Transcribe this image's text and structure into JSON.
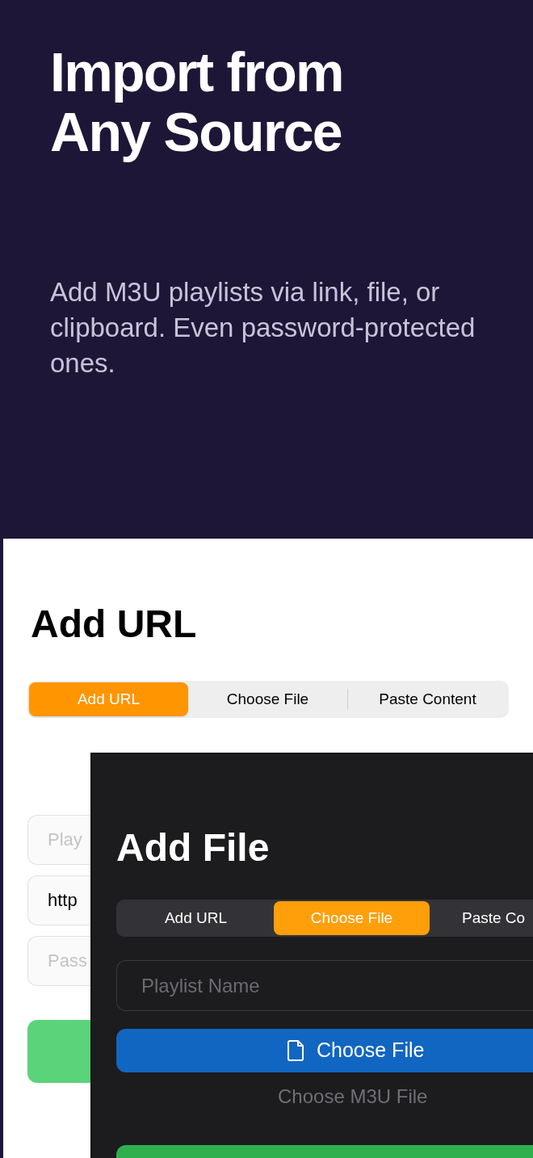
{
  "hero": {
    "title": "Import from Any Source",
    "subtitle": "Add M3U playlists via link, file, or clipboard. Even password-protected ones."
  },
  "url_screen": {
    "title": "Add URL",
    "tabs": [
      {
        "label": "Add URL",
        "selected": true
      },
      {
        "label": "Choose File",
        "selected": false
      },
      {
        "label": "Paste Content",
        "selected": false
      }
    ],
    "fields": [
      {
        "placeholder": "Play"
      },
      {
        "value": "http"
      },
      {
        "placeholder": "Pass"
      }
    ]
  },
  "file_screen": {
    "title": "Add File",
    "tabs": [
      {
        "label": "Add URL",
        "selected": false
      },
      {
        "label": "Choose File",
        "selected": true
      },
      {
        "label": "Paste Co",
        "selected": false
      }
    ],
    "name_field": {
      "placeholder": "Playlist Name"
    },
    "choose_button": {
      "label": "Choose File"
    },
    "caption": "Choose M3U File"
  }
}
